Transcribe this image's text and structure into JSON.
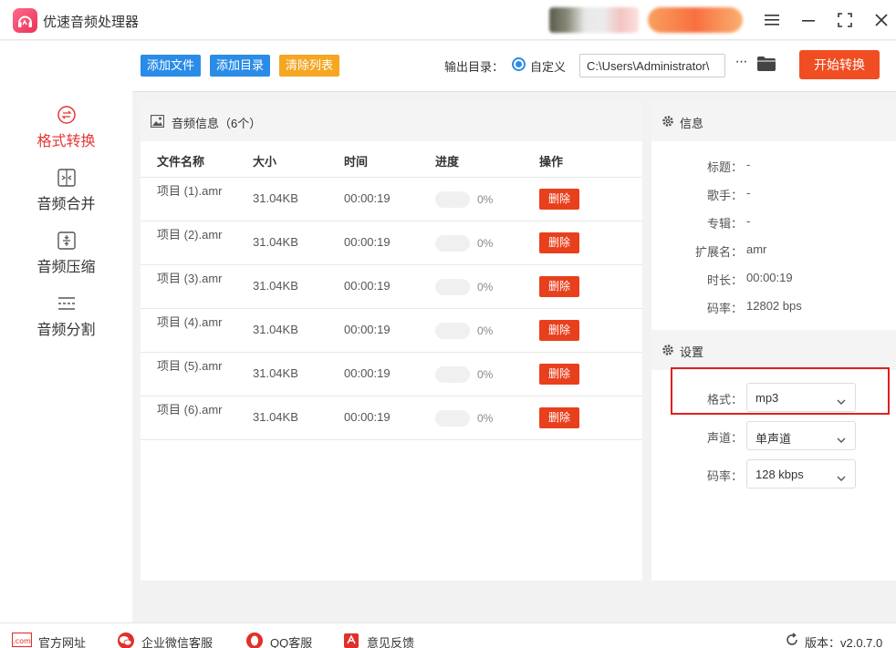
{
  "app": {
    "title": "优速音频处理器"
  },
  "colors": {
    "accent": "#e63535",
    "primary": "#2b8ce8",
    "start": "#f04d23",
    "delete": "#e8401c",
    "clear": "#f5a623"
  },
  "nav": [
    {
      "label": "格式转换",
      "icon": "format-convert-icon",
      "active": true
    },
    {
      "label": "音频合并",
      "icon": "audio-merge-icon",
      "active": false
    },
    {
      "label": "音频压缩",
      "icon": "audio-compress-icon",
      "active": false
    },
    {
      "label": "音频分割",
      "icon": "audio-split-icon",
      "active": false
    }
  ],
  "toolbar": {
    "add_file": "添加文件",
    "add_dir": "添加目录",
    "clear_list": "清除列表",
    "output_label": "输出目录：",
    "custom_label": "自定义",
    "path": "C:\\Users\\Administrator\\",
    "more": "···",
    "start": "开始转换"
  },
  "file_panel": {
    "title": "音频信息（6个）",
    "columns": {
      "name": "文件名称",
      "size": "大小",
      "time": "时间",
      "progress": "进度",
      "action": "操作"
    },
    "files": [
      {
        "name": "项目 (1).amr",
        "size": "31.04KB",
        "time": "00:00:19",
        "progress": 0,
        "progress_text": "0%",
        "action": "删除"
      },
      {
        "name": "项目 (2).amr",
        "size": "31.04KB",
        "time": "00:00:19",
        "progress": 0,
        "progress_text": "0%",
        "action": "删除"
      },
      {
        "name": "项目 (3).amr",
        "size": "31.04KB",
        "time": "00:00:19",
        "progress": 0,
        "progress_text": "0%",
        "action": "删除"
      },
      {
        "name": "项目 (4).amr",
        "size": "31.04KB",
        "time": "00:00:19",
        "progress": 0,
        "progress_text": "0%",
        "action": "删除"
      },
      {
        "name": "项目 (5).amr",
        "size": "31.04KB",
        "time": "00:00:19",
        "progress": 0,
        "progress_text": "0%",
        "action": "删除"
      },
      {
        "name": "项目 (6).amr",
        "size": "31.04KB",
        "time": "00:00:19",
        "progress": 0,
        "progress_text": "0%",
        "action": "删除"
      }
    ]
  },
  "info": {
    "title": "信息",
    "rows": [
      {
        "label": "标题：",
        "value": "-"
      },
      {
        "label": "歌手：",
        "value": "-"
      },
      {
        "label": "专辑：",
        "value": "-"
      },
      {
        "label": "扩展名：",
        "value": "amr"
      },
      {
        "label": "时长：",
        "value": "00:00:19"
      },
      {
        "label": "码率：",
        "value": "12802 bps"
      }
    ]
  },
  "settings": {
    "title": "设置",
    "format_label": "格式：",
    "format_value": "mp3",
    "channel_label": "声道：",
    "channel_value": "单声道",
    "bitrate_label": "码率：",
    "bitrate_value": "128 kbps"
  },
  "footer": {
    "website": "官方网址",
    "wechat": "企业微信客服",
    "qq": "QQ客服",
    "feedback": "意见反馈",
    "version": "版本：v2.0.7.0",
    "com_badge": ".com"
  }
}
